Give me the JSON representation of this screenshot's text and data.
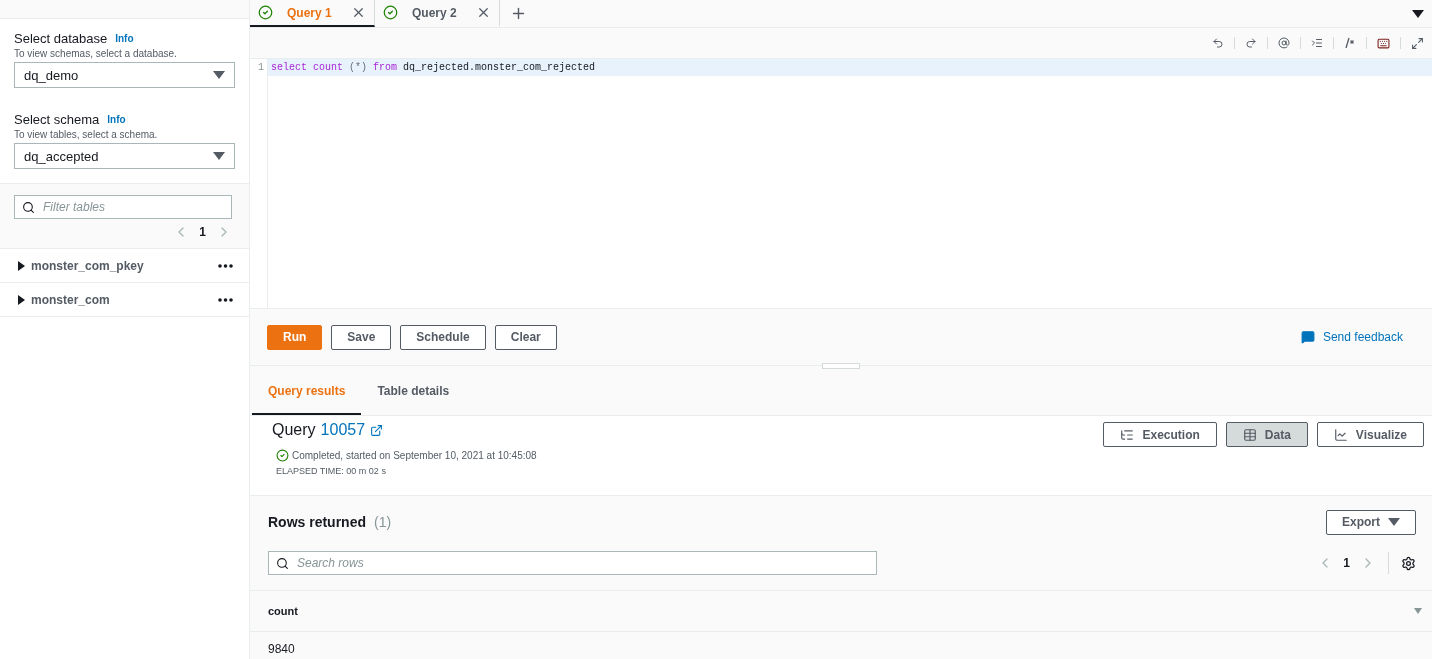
{
  "sidebar": {
    "selects": [
      {
        "label": "Select database",
        "info": "Info",
        "hint": "To view schemas, select a database.",
        "value": "dq_demo"
      },
      {
        "label": "Select schema",
        "info": "Info",
        "hint": "To view tables, select a schema.",
        "value": "dq_accepted"
      }
    ],
    "filter": {
      "placeholder": "Filter tables"
    },
    "page": "1",
    "tables": [
      {
        "name": "monster_com_pkey",
        "expanded": false
      },
      {
        "name": "monster_com",
        "expanded": false
      }
    ]
  },
  "query_tabs": [
    {
      "label": "Query 1",
      "selected": true
    },
    {
      "label": "Query 2",
      "selected": false
    }
  ],
  "editor": {
    "lines": [
      {
        "number": "1",
        "tokens": [
          {
            "kind": "keyword",
            "text": "select"
          },
          {
            "kind": "keyword",
            "text": "count"
          },
          {
            "kind": "punct",
            "text": "(*)"
          },
          {
            "kind": "keyword",
            "text": "from"
          },
          {
            "kind": "ident",
            "text": "dq_rejected.monster_com_rejected"
          }
        ]
      }
    ]
  },
  "buttons": [
    {
      "label": "Run",
      "kind": "primary"
    },
    {
      "label": "Save",
      "kind": "normal"
    },
    {
      "label": "Schedule",
      "kind": "normal"
    },
    {
      "label": "Clear",
      "kind": "normal"
    }
  ],
  "feedback": "Send feedback",
  "result_tabs": [
    {
      "label": "Query results",
      "selected": true
    },
    {
      "label": "Table details",
      "selected": false
    }
  ],
  "query": {
    "label": "Query",
    "id": "10057",
    "status": "Completed, started on September 10, 2021 at 10:45:08",
    "elapsed": "ELAPSED TIME: 00 m 02 s"
  },
  "view_buttons": [
    {
      "label": "Execution",
      "kind": "execution",
      "selected": false
    },
    {
      "label": "Data",
      "kind": "data",
      "selected": true
    },
    {
      "label": "Visualize",
      "kind": "visualize",
      "selected": false
    }
  ],
  "rows": {
    "title": "Rows returned",
    "count": "(1)",
    "export": "Export",
    "search": {
      "placeholder": "Search rows"
    },
    "page": "1",
    "columns": [
      "count"
    ],
    "cells": [
      [
        "9840"
      ]
    ]
  }
}
